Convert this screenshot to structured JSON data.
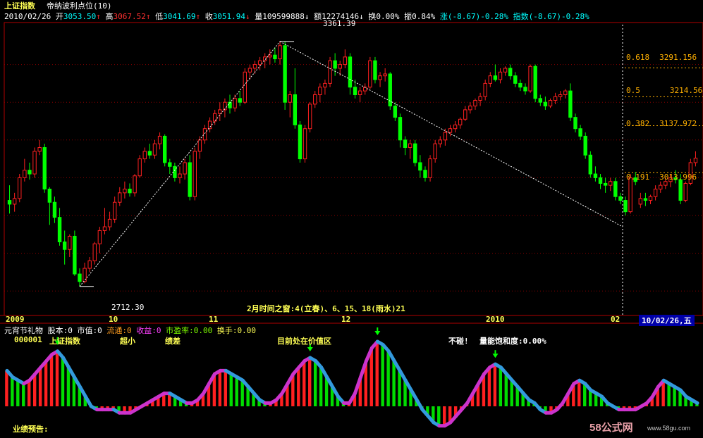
{
  "header": {
    "index_name": "上证指数",
    "indicator_name": "帝纳波利点位(10)",
    "date": "2010/02/26",
    "open_label": "开",
    "open": "3053.50",
    "high_label": "高",
    "high": "3067.52",
    "low_label": "低",
    "low": "3041.69",
    "close_label": "收",
    "close": "3051.94",
    "volume_label": "量",
    "volume": "109599888",
    "amount_label": "额",
    "amount": "12274146",
    "turnover_label": "换",
    "turnover": "0.00%",
    "amplitude_label": "振",
    "amplitude": "0.84%",
    "change_label": "涨",
    "change": "(-8.67)-0.28%",
    "index_change_label": "指数",
    "index_change": "(-8.67)-0.28%",
    "arrow_up": "↑",
    "arrow_down": "↓"
  },
  "fib_levels": [
    {
      "ratio": "0.618",
      "value": "3291.156"
    },
    {
      "ratio": "0.5",
      "value": "3214.564"
    },
    {
      "ratio": "0.382",
      "value": "3137.972"
    },
    {
      "ratio": "0.191",
      "value": "3013.996"
    }
  ],
  "annotations": {
    "peak": "3361.39",
    "trough": "2712.30",
    "time_window": "2月时间之窗:4(立春)、6、15、18(雨水)21"
  },
  "time_axis": {
    "labels": [
      "2009",
      "10",
      "11",
      "12",
      "2010",
      "02"
    ],
    "current": "10/02/26,五"
  },
  "lower_panel": {
    "row1": {
      "title": "元宵节礼物",
      "shares_label": "股本:",
      "shares": "0",
      "mktcap_label": "市值:",
      "mktcap": "0",
      "float_label": "流通:",
      "float": "0",
      "income_label": "收益:",
      "income": "0",
      "pe_label": "市盈率:",
      "pe": "0.00",
      "turnover_label": "换手:",
      "turnover": "0.00"
    },
    "row2": {
      "code": "000001",
      "name": "上证指数",
      "size": "超小",
      "performance": "绩差",
      "status": "目前处在价值区",
      "alert": "不碰!",
      "saturation_label": "量能饱和度:",
      "saturation": "0.00%"
    },
    "footer": "业绩预告:"
  },
  "watermark": {
    "brand": "58公式网",
    "url": "www.58gu.com"
  },
  "colors": {
    "up": "#ff2020",
    "down": "#00ff00",
    "fib_line": "#ffb000",
    "grid": "#8b0000",
    "axis": "#b00000",
    "cyan_line": "#3399dd",
    "purple_line": "#cc33cc"
  },
  "chart_data": {
    "type": "candlestick",
    "date_range": [
      "2009",
      "2010/02/26"
    ],
    "price_scale": {
      "min": 2650,
      "max": 3400
    },
    "candles": [
      {
        "o": 2940,
        "h": 2980,
        "l": 2905,
        "c": 2930
      },
      {
        "o": 2930,
        "h": 2960,
        "l": 2910,
        "c": 2945
      },
      {
        "o": 2945,
        "h": 3010,
        "l": 2935,
        "c": 3000
      },
      {
        "o": 3000,
        "h": 3050,
        "l": 2990,
        "c": 3020
      },
      {
        "o": 3020,
        "h": 3040,
        "l": 2995,
        "c": 3010
      },
      {
        "o": 3010,
        "h": 3080,
        "l": 3000,
        "c": 3070
      },
      {
        "o": 3070,
        "h": 3100,
        "l": 3060,
        "c": 3080
      },
      {
        "o": 3080,
        "h": 3090,
        "l": 2960,
        "c": 2970
      },
      {
        "o": 2970,
        "h": 2975,
        "l": 2875,
        "c": 2935
      },
      {
        "o": 2935,
        "h": 2950,
        "l": 2880,
        "c": 2895
      },
      {
        "o": 2895,
        "h": 2920,
        "l": 2820,
        "c": 2830
      },
      {
        "o": 2830,
        "h": 2860,
        "l": 2770,
        "c": 2810
      },
      {
        "o": 2810,
        "h": 2850,
        "l": 2790,
        "c": 2845
      },
      {
        "o": 2845,
        "h": 2860,
        "l": 2740,
        "c": 2745
      },
      {
        "o": 2745,
        "h": 2760,
        "l": 2712,
        "c": 2725
      },
      {
        "o": 2725,
        "h": 2775,
        "l": 2720,
        "c": 2760
      },
      {
        "o": 2760,
        "h": 2790,
        "l": 2750,
        "c": 2780
      },
      {
        "o": 2780,
        "h": 2830,
        "l": 2770,
        "c": 2825
      },
      {
        "o": 2825,
        "h": 2870,
        "l": 2800,
        "c": 2860
      },
      {
        "o": 2860,
        "h": 2920,
        "l": 2850,
        "c": 2870
      },
      {
        "o": 2870,
        "h": 2910,
        "l": 2860,
        "c": 2890
      },
      {
        "o": 2890,
        "h": 2950,
        "l": 2880,
        "c": 2935
      },
      {
        "o": 2935,
        "h": 2975,
        "l": 2925,
        "c": 2960
      },
      {
        "o": 2960,
        "h": 2990,
        "l": 2945,
        "c": 2970
      },
      {
        "o": 2970,
        "h": 2985,
        "l": 2950,
        "c": 2960
      },
      {
        "o": 2960,
        "h": 3010,
        "l": 2950,
        "c": 3005
      },
      {
        "o": 3005,
        "h": 3060,
        "l": 3000,
        "c": 3050
      },
      {
        "o": 3050,
        "h": 3080,
        "l": 3040,
        "c": 3070
      },
      {
        "o": 3070,
        "h": 3090,
        "l": 3050,
        "c": 3060
      },
      {
        "o": 3060,
        "h": 3100,
        "l": 3050,
        "c": 3090
      },
      {
        "o": 3090,
        "h": 3120,
        "l": 3075,
        "c": 3110
      },
      {
        "o": 3110,
        "h": 3115,
        "l": 3030,
        "c": 3040
      },
      {
        "o": 3040,
        "h": 3050,
        "l": 3010,
        "c": 3030
      },
      {
        "o": 3030,
        "h": 3040,
        "l": 2990,
        "c": 3000
      },
      {
        "o": 3000,
        "h": 3030,
        "l": 2985,
        "c": 3010
      },
      {
        "o": 3010,
        "h": 3050,
        "l": 2995,
        "c": 3040
      },
      {
        "o": 3040,
        "h": 3060,
        "l": 2940,
        "c": 2950
      },
      {
        "o": 2950,
        "h": 3080,
        "l": 2940,
        "c": 3070
      },
      {
        "o": 3070,
        "h": 3110,
        "l": 3050,
        "c": 3100
      },
      {
        "o": 3100,
        "h": 3140,
        "l": 3090,
        "c": 3130
      },
      {
        "o": 3130,
        "h": 3160,
        "l": 3120,
        "c": 3150
      },
      {
        "o": 3150,
        "h": 3180,
        "l": 3140,
        "c": 3170
      },
      {
        "o": 3170,
        "h": 3200,
        "l": 3150,
        "c": 3180
      },
      {
        "o": 3180,
        "h": 3210,
        "l": 3160,
        "c": 3200
      },
      {
        "o": 3200,
        "h": 3220,
        "l": 3170,
        "c": 3185
      },
      {
        "o": 3185,
        "h": 3220,
        "l": 3175,
        "c": 3210
      },
      {
        "o": 3210,
        "h": 3230,
        "l": 3190,
        "c": 3200
      },
      {
        "o": 3200,
        "h": 3290,
        "l": 3195,
        "c": 3280
      },
      {
        "o": 3280,
        "h": 3300,
        "l": 3260,
        "c": 3290
      },
      {
        "o": 3290,
        "h": 3310,
        "l": 3275,
        "c": 3300
      },
      {
        "o": 3300,
        "h": 3320,
        "l": 3285,
        "c": 3310
      },
      {
        "o": 3310,
        "h": 3330,
        "l": 3290,
        "c": 3320
      },
      {
        "o": 3320,
        "h": 3340,
        "l": 3300,
        "c": 3325
      },
      {
        "o": 3325,
        "h": 3345,
        "l": 3305,
        "c": 3315
      },
      {
        "o": 3315,
        "h": 3361,
        "l": 3300,
        "c": 3350
      },
      {
        "o": 3350,
        "h": 3361,
        "l": 3180,
        "c": 3200
      },
      {
        "o": 3200,
        "h": 3230,
        "l": 3160,
        "c": 3220
      },
      {
        "o": 3220,
        "h": 3290,
        "l": 3130,
        "c": 3140
      },
      {
        "o": 3140,
        "h": 3150,
        "l": 3040,
        "c": 3050
      },
      {
        "o": 3050,
        "h": 3140,
        "l": 3040,
        "c": 3130
      },
      {
        "o": 3130,
        "h": 3200,
        "l": 3120,
        "c": 3195
      },
      {
        "o": 3195,
        "h": 3230,
        "l": 3185,
        "c": 3220
      },
      {
        "o": 3220,
        "h": 3250,
        "l": 3200,
        "c": 3240
      },
      {
        "o": 3240,
        "h": 3260,
        "l": 3220,
        "c": 3250
      },
      {
        "o": 3250,
        "h": 3320,
        "l": 3240,
        "c": 3310
      },
      {
        "o": 3310,
        "h": 3330,
        "l": 3270,
        "c": 3290
      },
      {
        "o": 3290,
        "h": 3310,
        "l": 3270,
        "c": 3300
      },
      {
        "o": 3300,
        "h": 3340,
        "l": 3290,
        "c": 3320
      },
      {
        "o": 3320,
        "h": 3330,
        "l": 3220,
        "c": 3240
      },
      {
        "o": 3240,
        "h": 3260,
        "l": 3210,
        "c": 3220
      },
      {
        "o": 3220,
        "h": 3240,
        "l": 3200,
        "c": 3230
      },
      {
        "o": 3230,
        "h": 3250,
        "l": 3220,
        "c": 3240
      },
      {
        "o": 3240,
        "h": 3320,
        "l": 3235,
        "c": 3310
      },
      {
        "o": 3310,
        "h": 3320,
        "l": 3250,
        "c": 3260
      },
      {
        "o": 3260,
        "h": 3280,
        "l": 3240,
        "c": 3270
      },
      {
        "o": 3270,
        "h": 3290,
        "l": 3255,
        "c": 3275
      },
      {
        "o": 3275,
        "h": 3280,
        "l": 3180,
        "c": 3190
      },
      {
        "o": 3190,
        "h": 3200,
        "l": 3150,
        "c": 3160
      },
      {
        "o": 3160,
        "h": 3170,
        "l": 3080,
        "c": 3100
      },
      {
        "o": 3100,
        "h": 3110,
        "l": 3060,
        "c": 3080
      },
      {
        "o": 3080,
        "h": 3100,
        "l": 3050,
        "c": 3090
      },
      {
        "o": 3090,
        "h": 3100,
        "l": 3030,
        "c": 3040
      },
      {
        "o": 3040,
        "h": 3060,
        "l": 3000,
        "c": 3020
      },
      {
        "o": 3020,
        "h": 3030,
        "l": 2990,
        "c": 3000
      },
      {
        "o": 3000,
        "h": 3060,
        "l": 2990,
        "c": 3050
      },
      {
        "o": 3050,
        "h": 3100,
        "l": 3040,
        "c": 3090
      },
      {
        "o": 3090,
        "h": 3110,
        "l": 3080,
        "c": 3100
      },
      {
        "o": 3100,
        "h": 3130,
        "l": 3085,
        "c": 3120
      },
      {
        "o": 3120,
        "h": 3140,
        "l": 3110,
        "c": 3130
      },
      {
        "o": 3130,
        "h": 3150,
        "l": 3120,
        "c": 3140
      },
      {
        "o": 3140,
        "h": 3160,
        "l": 3130,
        "c": 3155
      },
      {
        "o": 3155,
        "h": 3190,
        "l": 3150,
        "c": 3180
      },
      {
        "o": 3180,
        "h": 3200,
        "l": 3170,
        "c": 3190
      },
      {
        "o": 3190,
        "h": 3210,
        "l": 3180,
        "c": 3205
      },
      {
        "o": 3205,
        "h": 3225,
        "l": 3190,
        "c": 3215
      },
      {
        "o": 3215,
        "h": 3260,
        "l": 3205,
        "c": 3250
      },
      {
        "o": 3250,
        "h": 3280,
        "l": 3240,
        "c": 3270
      },
      {
        "o": 3270,
        "h": 3300,
        "l": 3255,
        "c": 3260
      },
      {
        "o": 3260,
        "h": 3290,
        "l": 3250,
        "c": 3280
      },
      {
        "o": 3280,
        "h": 3295,
        "l": 3270,
        "c": 3290
      },
      {
        "o": 3290,
        "h": 3300,
        "l": 3260,
        "c": 3270
      },
      {
        "o": 3270,
        "h": 3280,
        "l": 3240,
        "c": 3250
      },
      {
        "o": 3250,
        "h": 3260,
        "l": 3230,
        "c": 3240
      },
      {
        "o": 3240,
        "h": 3250,
        "l": 3220,
        "c": 3230
      },
      {
        "o": 3230,
        "h": 3300,
        "l": 3225,
        "c": 3295
      },
      {
        "o": 3295,
        "h": 3300,
        "l": 3200,
        "c": 3210
      },
      {
        "o": 3210,
        "h": 3220,
        "l": 3190,
        "c": 3200
      },
      {
        "o": 3200,
        "h": 3215,
        "l": 3180,
        "c": 3190
      },
      {
        "o": 3190,
        "h": 3210,
        "l": 3185,
        "c": 3205
      },
      {
        "o": 3205,
        "h": 3225,
        "l": 3195,
        "c": 3215
      },
      {
        "o": 3215,
        "h": 3230,
        "l": 3205,
        "c": 3220
      },
      {
        "o": 3220,
        "h": 3235,
        "l": 3210,
        "c": 3230
      },
      {
        "o": 3230,
        "h": 3250,
        "l": 3150,
        "c": 3160
      },
      {
        "o": 3160,
        "h": 3170,
        "l": 3120,
        "c": 3130
      },
      {
        "o": 3130,
        "h": 3140,
        "l": 3100,
        "c": 3110
      },
      {
        "o": 3110,
        "h": 3120,
        "l": 3050,
        "c": 3060
      },
      {
        "o": 3060,
        "h": 3070,
        "l": 3000,
        "c": 3010
      },
      {
        "o": 3010,
        "h": 3030,
        "l": 2990,
        "c": 3000
      },
      {
        "o": 3000,
        "h": 3010,
        "l": 2970,
        "c": 2985
      },
      {
        "o": 2985,
        "h": 3000,
        "l": 2960,
        "c": 2980
      },
      {
        "o": 2980,
        "h": 3000,
        "l": 2965,
        "c": 2990
      },
      {
        "o": 2990,
        "h": 3000,
        "l": 2940,
        "c": 2950
      },
      {
        "o": 2950,
        "h": 2960,
        "l": 2930,
        "c": 2940
      },
      {
        "o": 2940,
        "h": 2950,
        "l": 2900,
        "c": 2910
      },
      {
        "o": 2910,
        "h": 3010,
        "l": 2905,
        "c": 3000
      },
      {
        "o": 3000,
        "h": 3015,
        "l": 2980,
        "c": 2990
      },
      {
        "o": 2930,
        "h": 2960,
        "l": 2920,
        "c": 2945
      },
      {
        "o": 2945,
        "h": 2960,
        "l": 2925,
        "c": 2940
      },
      {
        "o": 2940,
        "h": 2955,
        "l": 2930,
        "c": 2950
      },
      {
        "o": 2950,
        "h": 2980,
        "l": 2940,
        "c": 2970
      },
      {
        "o": 2970,
        "h": 2990,
        "l": 2960,
        "c": 2980
      },
      {
        "o": 2980,
        "h": 3000,
        "l": 2970,
        "c": 2990
      },
      {
        "o": 2990,
        "h": 3010,
        "l": 2975,
        "c": 3000
      },
      {
        "o": 3000,
        "h": 3020,
        "l": 2985,
        "c": 2995
      },
      {
        "o": 2995,
        "h": 3010,
        "l": 2930,
        "c": 2940
      },
      {
        "o": 2940,
        "h": 2990,
        "l": 2935,
        "c": 2985
      },
      {
        "o": 2985,
        "h": 3050,
        "l": 2980,
        "c": 3040
      },
      {
        "o": 3040,
        "h": 3070,
        "l": 3030,
        "c": 3052
      }
    ],
    "oscillator": {
      "type": "bar",
      "values": [
        0.55,
        0.45,
        0.4,
        0.35,
        0.4,
        0.5,
        0.6,
        0.7,
        0.8,
        0.85,
        0.75,
        0.6,
        0.45,
        0.3,
        0.15,
        0.0,
        -0.05,
        -0.05,
        -0.05,
        -0.05,
        -0.1,
        -0.1,
        -0.1,
        -0.05,
        0.0,
        0.05,
        0.1,
        0.15,
        0.2,
        0.2,
        0.15,
        0.1,
        0.05,
        0.05,
        0.1,
        0.2,
        0.35,
        0.5,
        0.55,
        0.55,
        0.5,
        0.45,
        0.4,
        0.3,
        0.2,
        0.1,
        0.05,
        0.05,
        0.1,
        0.2,
        0.35,
        0.5,
        0.6,
        0.7,
        0.75,
        0.7,
        0.6,
        0.45,
        0.3,
        0.15,
        0.05,
        0.05,
        0.2,
        0.45,
        0.7,
        0.9,
        1.0,
        0.95,
        0.85,
        0.7,
        0.55,
        0.4,
        0.25,
        0.1,
        -0.05,
        -0.15,
        -0.25,
        -0.3,
        -0.3,
        -0.25,
        -0.15,
        -0.05,
        0.05,
        0.2,
        0.35,
        0.5,
        0.6,
        0.65,
        0.6,
        0.5,
        0.4,
        0.3,
        0.2,
        0.1,
        0.05,
        -0.05,
        -0.1,
        -0.1,
        -0.05,
        0.05,
        0.2,
        0.35,
        0.4,
        0.35,
        0.25,
        0.2,
        0.15,
        0.05,
        0.0,
        -0.05,
        -0.05,
        -0.05,
        -0.05,
        0.0,
        0.05,
        0.15,
        0.3,
        0.4,
        0.35,
        0.3,
        0.25,
        0.15,
        0.1,
        0.05
      ]
    }
  }
}
